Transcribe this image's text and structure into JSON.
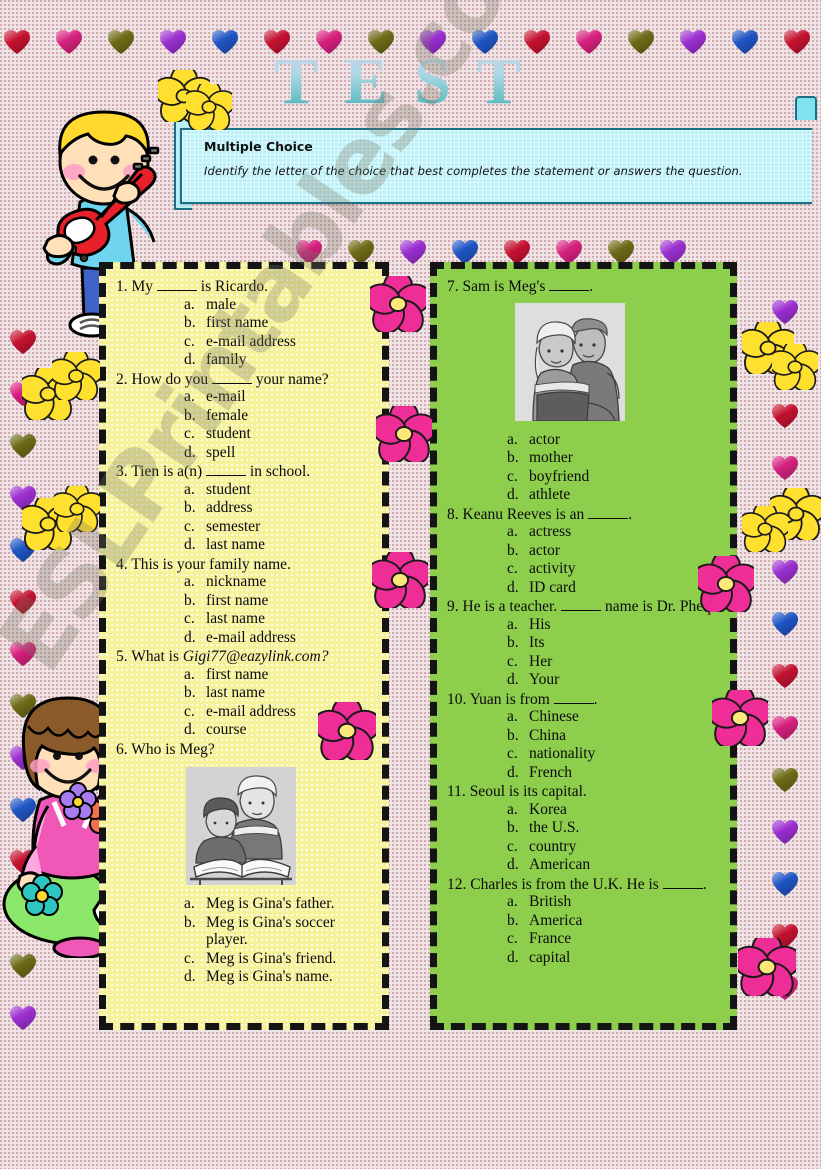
{
  "title": "TEST",
  "instructions": {
    "heading": "Multiple Choice",
    "body": "Identify the letter of the choice that best completes the statement or answers the  question."
  },
  "watermark": "ESLPrintables.com",
  "colors": {
    "page_bg": "#f0e3e5",
    "left_panel": "#f6f29a",
    "right_panel": "#8dce4d",
    "instruction_box": "#b8f0f7",
    "instruction_border": "#1b6f86",
    "panel_border": "#141414",
    "title_gradient_start": "#cfd0ea",
    "title_gradient_end": "#2f9fae"
  },
  "heart_colors": [
    "#c41230",
    "#d6217e",
    "#6d6b17",
    "#9b2fd0",
    "#1f55c4"
  ],
  "left_column": [
    {
      "number": "1.",
      "before": "My ",
      "after": " is Ricardo.",
      "options": [
        {
          "letter": "a.",
          "text": "male"
        },
        {
          "letter": "b.",
          "text": "first name"
        },
        {
          "letter": "c.",
          "text": "e-mail address"
        },
        {
          "letter": "d.",
          "text": "family"
        }
      ]
    },
    {
      "number": "2.",
      "before": "How do you ",
      "after": " your name?",
      "options": [
        {
          "letter": "a.",
          "text": "e-mail"
        },
        {
          "letter": "b.",
          "text": "female"
        },
        {
          "letter": "c.",
          "text": "student"
        },
        {
          "letter": "d.",
          "text": "spell"
        }
      ]
    },
    {
      "number": "3.",
      "before": "Tien is a(n) ",
      "after": " in school.",
      "options": [
        {
          "letter": "a.",
          "text": "student"
        },
        {
          "letter": "b.",
          "text": "address"
        },
        {
          "letter": "c.",
          "text": "semester"
        },
        {
          "letter": "d.",
          "text": "last name"
        }
      ]
    },
    {
      "number": "4.",
      "before": "This is your family name.",
      "after": "",
      "no_blank": true,
      "options": [
        {
          "letter": "a.",
          "text": "nickname"
        },
        {
          "letter": "b.",
          "text": "first name"
        },
        {
          "letter": "c.",
          "text": "last name"
        },
        {
          "letter": "d.",
          "text": "e-mail address"
        }
      ]
    },
    {
      "number": "5.",
      "before": "What is ",
      "italic": "Gigi77@eazylink.com?",
      "after": "",
      "no_blank": true,
      "options": [
        {
          "letter": "a.",
          "text": "first name"
        },
        {
          "letter": "b.",
          "text": "last name"
        },
        {
          "letter": "c.",
          "text": "e-mail address"
        },
        {
          "letter": "d.",
          "text": "course"
        }
      ]
    },
    {
      "number": "6.",
      "before": "Who is Meg?",
      "after": "",
      "no_blank": true,
      "image": "girls-reading-book-photo",
      "options": [
        {
          "letter": "a.",
          "text": "Meg is Gina's father."
        },
        {
          "letter": "b.",
          "text": "Meg is Gina's soccer player."
        },
        {
          "letter": "c.",
          "text": "Meg is Gina's friend."
        },
        {
          "letter": "d.",
          "text": "Meg is Gina's name."
        }
      ]
    }
  ],
  "right_column": [
    {
      "number": "7.",
      "before": "Sam is Meg's ",
      "after": ".",
      "image": "couple-photo",
      "options": [
        {
          "letter": "a.",
          "text": "actor"
        },
        {
          "letter": "b.",
          "text": "mother"
        },
        {
          "letter": "c.",
          "text": "boyfriend"
        },
        {
          "letter": "d.",
          "text": "athlete"
        }
      ]
    },
    {
      "number": "8.",
      "before": "Keanu Reeves is an ",
      "after": ".",
      "options": [
        {
          "letter": "a.",
          "text": "actress"
        },
        {
          "letter": "b.",
          "text": "actor"
        },
        {
          "letter": "c.",
          "text": "activity"
        },
        {
          "letter": "d.",
          "text": "ID card"
        }
      ]
    },
    {
      "number": "9.",
      "before": "He is a teacher. ",
      "after": " name is Dr. Phelps.",
      "options": [
        {
          "letter": "a.",
          "text": "His"
        },
        {
          "letter": "b.",
          "text": "Its"
        },
        {
          "letter": "c.",
          "text": "Her"
        },
        {
          "letter": "d.",
          "text": "Your"
        }
      ]
    },
    {
      "number": "10.",
      "before": "Yuan is from ",
      "after": ".",
      "options": [
        {
          "letter": "a.",
          "text": "Chinese"
        },
        {
          "letter": "b.",
          "text": "China"
        },
        {
          "letter": "c.",
          "text": "nationality"
        },
        {
          "letter": "d.",
          "text": "French"
        }
      ]
    },
    {
      "number": "11.",
      "before": "Seoul is its capital.",
      "after": "",
      "no_blank": true,
      "options": [
        {
          "letter": "a.",
          "text": "Korea"
        },
        {
          "letter": "b.",
          "text": "the U.S."
        },
        {
          "letter": "c.",
          "text": "country"
        },
        {
          "letter": "d.",
          "text": "American"
        }
      ]
    },
    {
      "number": "12.",
      "before": "Charles is from the U.K. He is ",
      "after": ".",
      "options": [
        {
          "letter": "a.",
          "text": "British"
        },
        {
          "letter": "b.",
          "text": "America"
        },
        {
          "letter": "c.",
          "text": "France"
        },
        {
          "letter": "d.",
          "text": "capital"
        }
      ]
    }
  ],
  "decorations": {
    "boy_illustration": "boy-playing-red-guitar",
    "girl_illustration": "girl-sitting-with-flowers",
    "yellow_flower": "yellow-flower",
    "pink_flower": "pink-flower"
  }
}
